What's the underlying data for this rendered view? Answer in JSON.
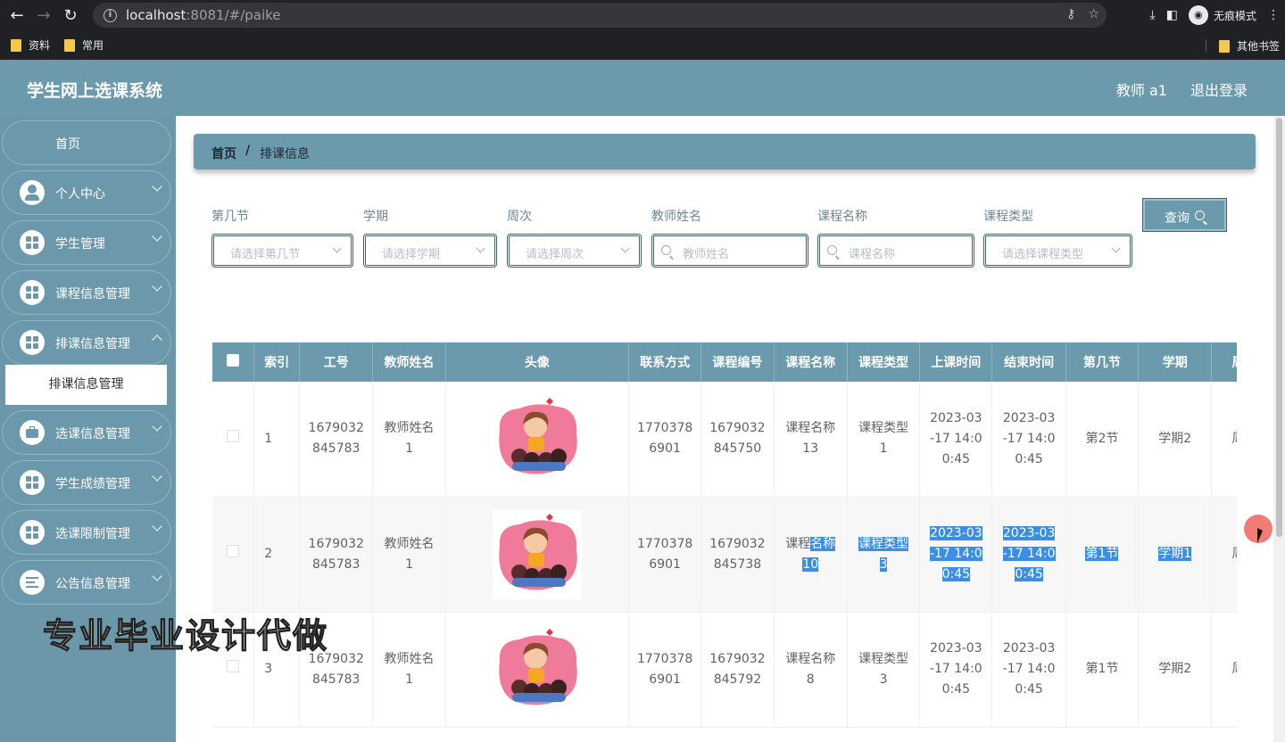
{
  "browser": {
    "url_host": "localhost",
    "url_rest": ":8081/#/paike",
    "incognito_label": "无痕模式",
    "bookmarks": [
      "资料",
      "常用"
    ],
    "other_bookmarks": "其他书签"
  },
  "header": {
    "title": "学生网上选课系统",
    "user": "教师 a1",
    "logout": "退出登录"
  },
  "sidebar": {
    "items": [
      {
        "label": "首页",
        "icon": "home"
      },
      {
        "label": "个人中心",
        "icon": "user-icon"
      },
      {
        "label": "学生管理",
        "icon": "grid-icon"
      },
      {
        "label": "课程信息管理",
        "icon": "grid-icon"
      },
      {
        "label": "排课信息管理",
        "icon": "grid-icon"
      },
      {
        "label": "选课信息管理",
        "icon": "briefcase-icon"
      },
      {
        "label": "学生成绩管理",
        "icon": "grid-icon"
      },
      {
        "label": "选课限制管理",
        "icon": "grid-icon"
      },
      {
        "label": "公告信息管理",
        "icon": "list-icon"
      }
    ],
    "active_sub": "排课信息管理"
  },
  "breadcrumb": {
    "home": "首页",
    "sep": "/",
    "current": "排课信息"
  },
  "filters": [
    {
      "label": "第几节",
      "placeholder": "请选择第几节",
      "type": "select"
    },
    {
      "label": "学期",
      "placeholder": "请选择学期",
      "type": "select"
    },
    {
      "label": "周次",
      "placeholder": "请选择周次",
      "type": "select"
    },
    {
      "label": "教师姓名",
      "placeholder": "教师姓名",
      "type": "search"
    },
    {
      "label": "课程名称",
      "placeholder": "课程名称",
      "type": "search"
    },
    {
      "label": "课程类型",
      "placeholder": "请选择课程类型",
      "type": "select"
    }
  ],
  "query_button": "查询",
  "table": {
    "columns": [
      "索引",
      "工号",
      "教师姓名",
      "头像",
      "联系方式",
      "课程编号",
      "课程名称",
      "课程类型",
      "上课时间",
      "结束时间",
      "第几节",
      "学期",
      "周次"
    ],
    "rows": [
      {
        "index": "1",
        "gonghao": "1679032\n845783",
        "teacher": "教师姓名\n1",
        "phone": "1770378\n6901",
        "course_no": "1679032\n845750",
        "course_name": "课程名称\n13",
        "course_type": "课程类型\n1",
        "start": "2023-03\n-17 14:0\n0:45",
        "end": "2023-03\n-17 14:0\n0:45",
        "section": "第2节",
        "term": "学期2",
        "week": "周次"
      },
      {
        "index": "2",
        "gonghao": "1679032\n845783",
        "teacher": "教师姓名\n1",
        "phone": "1770378\n6901",
        "course_no": "1679032\n845738",
        "course_name": "课程名称\n10",
        "course_type": "课程类型\n3",
        "start": "2023-03\n-17 14:0\n0:45",
        "end": "2023-03\n-17 14:0\n0:45",
        "section": "第1节",
        "term": "学期1",
        "week": "周次"
      },
      {
        "index": "3",
        "gonghao": "1679032\n845783",
        "teacher": "教师姓名\n1",
        "phone": "1770378\n6901",
        "course_no": "1679032\n845792",
        "course_name": "课程名称\n8",
        "course_type": "课程类型\n3",
        "start": "2023-03\n-17 14:0\n0:45",
        "end": "2023-03\n-17 14:0\n0:45",
        "section": "第1节",
        "term": "学期2",
        "week": "周次"
      }
    ]
  },
  "watermark": "专业毕业设计代做",
  "colors": {
    "theme": "#6b9aad",
    "selection": "#3a8ee6"
  }
}
